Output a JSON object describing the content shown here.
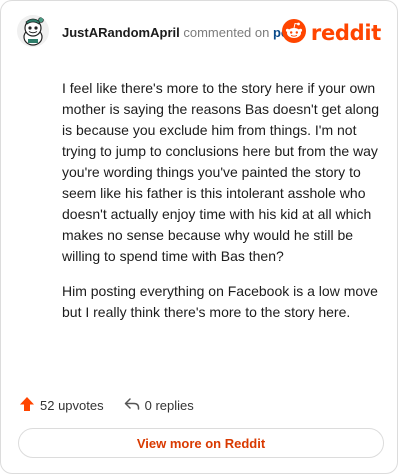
{
  "header": {
    "username": "JustARandomApril",
    "commented_text": "commented on",
    "post_link": "post",
    "brand_word": "reddit"
  },
  "comment": {
    "paragraphs": [
      "I feel like there's more to the story here if your own mother is saying the reasons Bas doesn't get along is because you exclude him from things. I'm not trying to jump to conclusions here but from the way you're wording things you've painted the story to seem like his father is this intolerant asshole who doesn't actually enjoy time with his kid at all which makes no sense because why would he still be willing to spend time with Bas then?",
      "Him posting everything on Facebook is a low move but I really think there's more to the story here."
    ]
  },
  "footer": {
    "upvotes": "52 upvotes",
    "replies": "0 replies",
    "view_more": "View more on Reddit"
  },
  "colors": {
    "brand": "#ff4500",
    "link": "#0a4a8a",
    "view_more_text": "#d93900"
  },
  "icons": {
    "avatar": "snoo-avatar-icon",
    "logo": "reddit-snoo-icon",
    "upvote": "upvote-arrow-icon",
    "reply": "reply-arrow-icon"
  }
}
